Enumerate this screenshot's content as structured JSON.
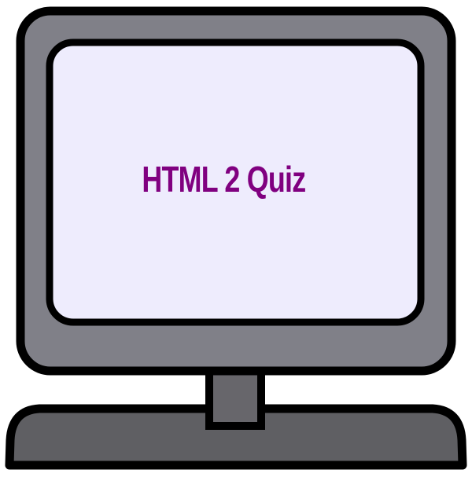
{
  "screen": {
    "title": "HTML 2 Quiz"
  },
  "colors": {
    "outline": "#000000",
    "bezel": "#808088",
    "screen": "#eeecfd",
    "stand": "#67666b",
    "base": "#5f5f63",
    "title": "#800080"
  },
  "icons": {
    "illustration": "computer-monitor-icon"
  }
}
